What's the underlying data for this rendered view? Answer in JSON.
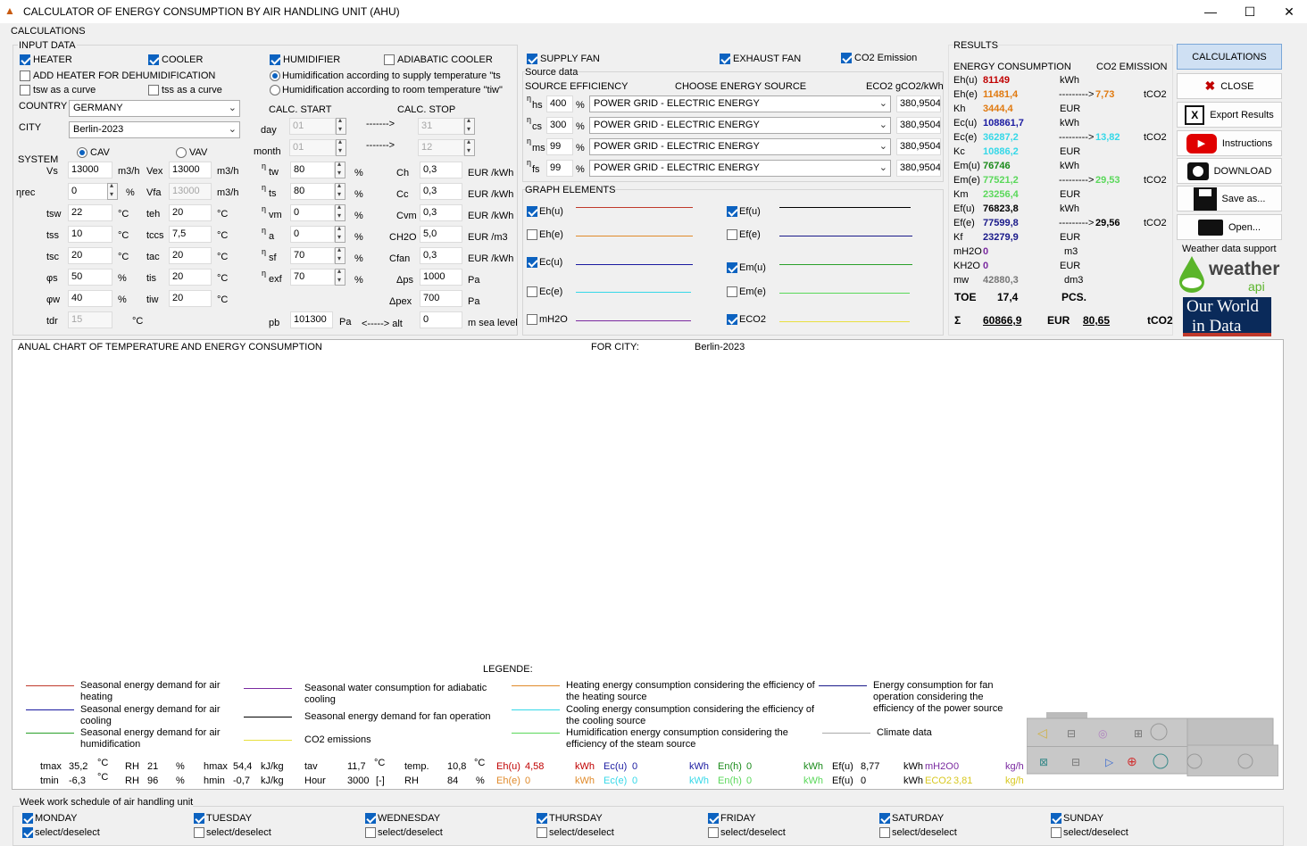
{
  "window": {
    "title": "CALCULATOR OF ENERGY CONSUMPTION BY AIR HANDLING UNIT (AHU)",
    "minimize": "—",
    "maximize": "☐",
    "close": "✕"
  },
  "calc_group": "CALCULATIONS",
  "input_group": "INPUT DATA",
  "checks": {
    "heater": "HEATER",
    "cooler": "COOLER",
    "humidifier": "HUMIDIFIER",
    "adiabatic": "ADIABATIC COOLER",
    "add_heater": "ADD HEATER FOR DEHUMIDIFICATION",
    "tsw_curve": "tsw as a curve",
    "tss_curve": "tss as a curve",
    "supply_fan": "SUPPLY FAN",
    "exhaust_fan": "EXHAUST FAN",
    "co2": "CO2 Emission"
  },
  "humid_radio": {
    "supply": "Humidification according to supply temperature \"ts",
    "room": "Humidification according to room temperature \"tiw\""
  },
  "country_label": "COUNTRY",
  "country": "GERMANY",
  "city_label": "CITY",
  "city": "Berlin-2023",
  "system_label": "SYSTEM",
  "cav": "CAV",
  "vav": "VAV",
  "calc_start": "CALC. START",
  "calc_stop": "CALC. STOP",
  "day": "day",
  "month": "month",
  "start_day": "01",
  "start_month": "01",
  "stop_day": "31",
  "stop_month": "12",
  "arrow": "------->",
  "params_left": [
    {
      "l": "Vs",
      "v": "13000",
      "u": "m3/h"
    },
    {
      "l": "ηrec",
      "v": "0",
      "u": "%"
    },
    {
      "l": "tsw",
      "v": "22",
      "u": "°C"
    },
    {
      "l": "tss",
      "v": "10",
      "u": "°C"
    },
    {
      "l": "tsc",
      "v": "20",
      "u": "°C"
    },
    {
      "l": "φs",
      "v": "50",
      "u": "%"
    },
    {
      "l": "φw",
      "v": "40",
      "u": "%"
    },
    {
      "l": "tdr",
      "v": "15",
      "u": "°C"
    }
  ],
  "params_mid": [
    {
      "l": "Vex",
      "v": "13000",
      "u": "m3/h"
    },
    {
      "l": "Vfa",
      "v": "13000",
      "u": "m3/h"
    },
    {
      "l": "teh",
      "v": "20",
      "u": "°C"
    },
    {
      "l": "tccs",
      "v": "7,5",
      "u": "°C"
    },
    {
      "l": "tac",
      "v": "20",
      "u": "°C"
    },
    {
      "l": "tis",
      "v": "20",
      "u": "°C"
    },
    {
      "l": "tiw",
      "v": "20",
      "u": "°C"
    }
  ],
  "params_eta": [
    {
      "l": "η",
      "s": "tw",
      "v": "80"
    },
    {
      "l": "η",
      "s": "ts",
      "v": "80"
    },
    {
      "l": "η",
      "s": "vm",
      "v": "0"
    },
    {
      "l": "η",
      "s": "a",
      "v": "0"
    },
    {
      "l": "η",
      "s": "sf",
      "v": "70"
    },
    {
      "l": "η",
      "s": "exf",
      "v": "70"
    }
  ],
  "eta_unit": "%",
  "costs": [
    {
      "l": "Ch",
      "v": "0,3",
      "u": "EUR /kWh"
    },
    {
      "l": "Cc",
      "v": "0,3",
      "u": "EUR /kWh"
    },
    {
      "l": "Cvm",
      "v": "0,3",
      "u": "EUR /kWh"
    },
    {
      "l": "CH2O",
      "v": "5,0",
      "u": "EUR /m3"
    },
    {
      "l": "Cfan",
      "v": "0,3",
      "u": "EUR /kWh"
    },
    {
      "l": "Δps",
      "v": "1000",
      "u": "Pa"
    },
    {
      "l": "Δpex",
      "v": "700",
      "u": "Pa"
    }
  ],
  "pb_label": "pb",
  "pb": "101300",
  "pb_unit": "Pa",
  "alt_arrow": "<-----> alt",
  "alt": "0",
  "alt_unit": "m sea level",
  "source": {
    "title": "Source data",
    "eff_h": "SOURCE EFFICIENCY",
    "choose_h": "CHOOSE ENERGY SOURCE",
    "eco2_h": "ECO2 gCO2/kWh",
    "rows": [
      {
        "s": "hs",
        "eff": "400",
        "src": "POWER GRID - ELECTRIC ENERGY",
        "eco2": "380,9504"
      },
      {
        "s": "cs",
        "eff": "300",
        "src": "POWER GRID - ELECTRIC ENERGY",
        "eco2": "380,9504"
      },
      {
        "s": "ms",
        "eff": "99",
        "src": "POWER GRID - ELECTRIC ENERGY",
        "eco2": "380,9504"
      },
      {
        "s": "fs",
        "eff": "99",
        "src": "POWER GRID - ELECTRIC ENERGY",
        "eco2": "380,9504"
      }
    ],
    "pct": "%"
  },
  "graph": {
    "title": "GRAPH ELEMENTS",
    "items": [
      {
        "n": "Eh(u)",
        "on": true,
        "c": "#c0392b"
      },
      {
        "n": "Ef(u)",
        "on": true,
        "c": "#000000"
      },
      {
        "n": "Eh(e)",
        "on": false,
        "c": "#e08a2a"
      },
      {
        "n": "Ef(e)",
        "on": false,
        "c": "#1a1a8a"
      },
      {
        "n": "Ec(u)",
        "on": true,
        "c": "#1a1aa0"
      },
      {
        "n": "Em(u)",
        "on": true,
        "c": "#2aa02a"
      },
      {
        "n": "Ec(e)",
        "on": false,
        "c": "#35d8e8"
      },
      {
        "n": "Em(e)",
        "on": false,
        "c": "#5ad85a"
      },
      {
        "n": "mH2O",
        "on": false,
        "c": "#7a2aa0"
      },
      {
        "n": "ECO2",
        "on": true,
        "c": "#e8e040"
      }
    ]
  },
  "results": {
    "title": "RESULTS",
    "energy_h": "ENERGY CONSUMPTION",
    "co2_h": "CO2 EMISSION",
    "rows": [
      {
        "l": "Eh(u)",
        "v": "81149",
        "c": "#c00000",
        "u": "kWh",
        "a": "",
        "co2": "",
        "cu": ""
      },
      {
        "l": "Eh(e)",
        "v": "11481,4",
        "c": "#e07a10",
        "u": "",
        "a": "--------->",
        "co2": "7,73",
        "cc": "#e07a10",
        "cu": "tCO2"
      },
      {
        "l": "Kh",
        "v": "3444,4",
        "c": "#e07a10",
        "u": "EUR",
        "a": "",
        "co2": "",
        "cu": ""
      },
      {
        "l": "Ec(u)",
        "v": "108861,7",
        "c": "#1a1aa0",
        "u": "kWh",
        "a": "",
        "co2": "",
        "cu": ""
      },
      {
        "l": "Ec(e)",
        "v": "36287,2",
        "c": "#35d8e8",
        "u": "",
        "a": "--------->",
        "co2": "13,82",
        "cc": "#35d8e8",
        "cu": "tCO2"
      },
      {
        "l": "Kc",
        "v": "10886,2",
        "c": "#35d8e8",
        "u": "EUR",
        "a": "",
        "co2": "",
        "cu": ""
      },
      {
        "l": "Em(u)",
        "v": "76746",
        "c": "#1a8a1a",
        "u": "kWh",
        "a": "",
        "co2": "",
        "cu": ""
      },
      {
        "l": "Em(e)",
        "v": "77521,2",
        "c": "#5ad85a",
        "u": "",
        "a": "--------->",
        "co2": "29,53",
        "cc": "#5ad85a",
        "cu": "tCO2"
      },
      {
        "l": "Km",
        "v": "23256,4",
        "c": "#5ad85a",
        "u": "EUR",
        "a": "",
        "co2": "",
        "cu": ""
      },
      {
        "l": "Ef(u)",
        "v": "76823,8",
        "c": "#000",
        "u": "kWh",
        "a": "",
        "co2": "",
        "cu": ""
      },
      {
        "l": "Ef(e)",
        "v": "77599,8",
        "c": "#1a1a8a",
        "u": "",
        "a": "--------->",
        "co2": "29,56",
        "cc": "#000",
        "cu": "tCO2"
      },
      {
        "l": "Kf",
        "v": "23279,9",
        "c": "#1a1a8a",
        "u": "EUR",
        "a": "",
        "co2": "",
        "cu": ""
      },
      {
        "l": "mH2O",
        "v": "0",
        "c": "#7a2aa0",
        "u": "m3",
        "a": "",
        "co2": "",
        "cu": ""
      },
      {
        "l": "KH2O",
        "v": "0",
        "c": "#7a2aa0",
        "u": "EUR",
        "a": "",
        "co2": "",
        "cu": ""
      },
      {
        "l": "mw",
        "v": "42880,3",
        "c": "#777",
        "u": "dm3",
        "a": "",
        "co2": "",
        "cu": ""
      }
    ],
    "toe_l": "TOE",
    "toe_v": "17,4",
    "pcs": "PCS.",
    "sum_sym": "Σ",
    "sum_v": "60866,9",
    "sum_u": "EUR",
    "sum_co2": "80,65",
    "sum_co2_u": "tCO2"
  },
  "buttons": {
    "calc": "CALCULATIONS",
    "close": "CLOSE",
    "export": "Export Results",
    "instructions": "Instructions",
    "download": "DOWNLOAD",
    "save": "Save as...",
    "open": "Open..."
  },
  "weather": {
    "support": "Weather data support",
    "brand": "weather",
    "api": "api",
    "owid1": "Our World",
    "owid2": "in Data"
  },
  "chart": {
    "title": "ANUAL CHART OF TEMPERATURE AND ENERGY CONSUMPTION",
    "for_city": "FOR CITY:",
    "city": "Berlin-2023",
    "legend_title": "LEGENDE:"
  },
  "legend": [
    {
      "t": "Seasonal energy demand for air heating",
      "c": "#c0392b"
    },
    {
      "t": "Seasonal energy demand for air cooling",
      "c": "#1a1aa0"
    },
    {
      "t": "Seasonal energy demand for air humidification",
      "c": "#2aa02a"
    },
    {
      "t": "Seasonal water consumption for adiabatic cooling",
      "c": "#7a2aa0"
    },
    {
      "t": "Seasonal energy demand for fan operation",
      "c": "#000000"
    },
    {
      "t": "CO2 emissions",
      "c": "#e8e040"
    },
    {
      "t": "Heating energy consumption considering the efficiency of the heating source",
      "c": "#e08a2a"
    },
    {
      "t": "Cooling energy consumption considering the efficiency of the cooling source",
      "c": "#35d8e8"
    },
    {
      "t": "Humidification energy consumption considering the efficiency of the steam source",
      "c": "#5ad85a"
    },
    {
      "t": "Energy consumption for fan operation considering the efficiency of the power source",
      "c": "#1a1a8a"
    },
    {
      "t": "Climate data",
      "c": "#aaaaaa"
    }
  ],
  "stats1": {
    "tmax": "tmax",
    "tmax_v": "35,2",
    "u1": "°C",
    "rh": "RH",
    "rh_v": "21",
    "p": "%",
    "hmax": "hmax",
    "hmax_v": "54,4",
    "kj": "kJ/kg",
    "tav": "tav",
    "tav_v": "11,7",
    "temp": "temp.",
    "temp_v": "10,8"
  },
  "stats2": {
    "tmin": "tmin",
    "tmin_v": "-6,3",
    "rh_v": "96",
    "hmin": "hmin",
    "hmin_v": "-0,7",
    "hour": "Hour",
    "hour_v": "3000",
    "hour_u": "[-]",
    "rh2": "RH",
    "rh2_v": "84"
  },
  "energy_line1": [
    {
      "l": "Eh(u)",
      "v": "4,58",
      "c": "#c00000",
      "u": "kWh"
    },
    {
      "l": "Ec(u)",
      "v": "0",
      "c": "#1a1aa0",
      "u": "kWh"
    },
    {
      "l": "En(h)",
      "v": "0",
      "c": "#1a8a1a",
      "u": "kWh"
    },
    {
      "l": "Ef(u)",
      "v": "8,77",
      "c": "#000",
      "u": "kWh"
    },
    {
      "l": "mH2O",
      "v": "0",
      "c": "#7a2aa0",
      "u": "kg/h"
    }
  ],
  "energy_line2": [
    {
      "l": "Eh(e)",
      "v": "0",
      "c": "#e08a2a",
      "u": "kWh"
    },
    {
      "l": "Ec(e)",
      "v": "0",
      "c": "#35d8e8",
      "u": "kWh"
    },
    {
      "l": "En(h)",
      "v": "0",
      "c": "#5ad85a",
      "u": "kWh"
    },
    {
      "l": "Ef(u)",
      "v": "0",
      "c": "#000",
      "u": "kWh"
    },
    {
      "l": "ECO2",
      "v": "3,81",
      "c": "#d8c820",
      "u": "kg/h"
    }
  ],
  "schedule": {
    "title": "Week work schedule of air handling unit",
    "days": [
      {
        "d": "MONDAY",
        "on": true,
        "sel_on": true
      },
      {
        "d": "TUESDAY",
        "on": true,
        "sel_on": false
      },
      {
        "d": "WEDNESDAY",
        "on": true,
        "sel_on": false
      },
      {
        "d": "THURSDAY",
        "on": true,
        "sel_on": false
      },
      {
        "d": "FRIDAY",
        "on": true,
        "sel_on": false
      },
      {
        "d": "SATURDAY",
        "on": true,
        "sel_on": false
      },
      {
        "d": "SUNDAY",
        "on": true,
        "sel_on": false
      }
    ],
    "sel": "select/deselect"
  }
}
